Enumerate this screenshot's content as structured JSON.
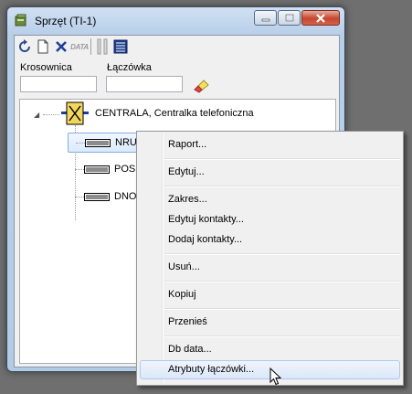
{
  "window": {
    "title": "Sprzęt (TI-1)",
    "controls": [
      "minimize-icon",
      "maximize-icon",
      "close-icon"
    ]
  },
  "toolbar": {
    "buttons": [
      "refresh-icon",
      "new-document-icon",
      "delete-icon",
      "data-icon",
      "columns-icon",
      "list-icon"
    ],
    "data_label": "DATA"
  },
  "filters": {
    "krosownica_label": "Krosownica",
    "krosownica_value": "",
    "laczowka_label": "Łączówka",
    "laczowka_value": "",
    "clear_icon": "eraser-icon"
  },
  "tree": {
    "root": {
      "label": "CENTRALA, Centralka telefoniczna",
      "icon": "switchboard-icon",
      "expanded": true
    },
    "children": [
      {
        "label": "NRU",
        "icon": "terminal-block-icon",
        "selected": true
      },
      {
        "label": "POS",
        "icon": "terminal-block-icon",
        "selected": false
      },
      {
        "label": "DNO",
        "icon": "terminal-block-icon",
        "selected": false
      }
    ]
  },
  "context_menu": {
    "items": [
      {
        "label": "Raport..."
      },
      {
        "label": "Edytuj..."
      },
      {
        "label": "Zakres..."
      },
      {
        "label": "Edytuj kontakty..."
      },
      {
        "label": "Dodaj kontakty..."
      },
      {
        "label": "Usuń..."
      },
      {
        "label": "Kopiuj"
      },
      {
        "label": "Przenieś"
      },
      {
        "label": "Db data..."
      },
      {
        "label": "Atrybuty łączówki...",
        "highlighted": true
      }
    ]
  }
}
